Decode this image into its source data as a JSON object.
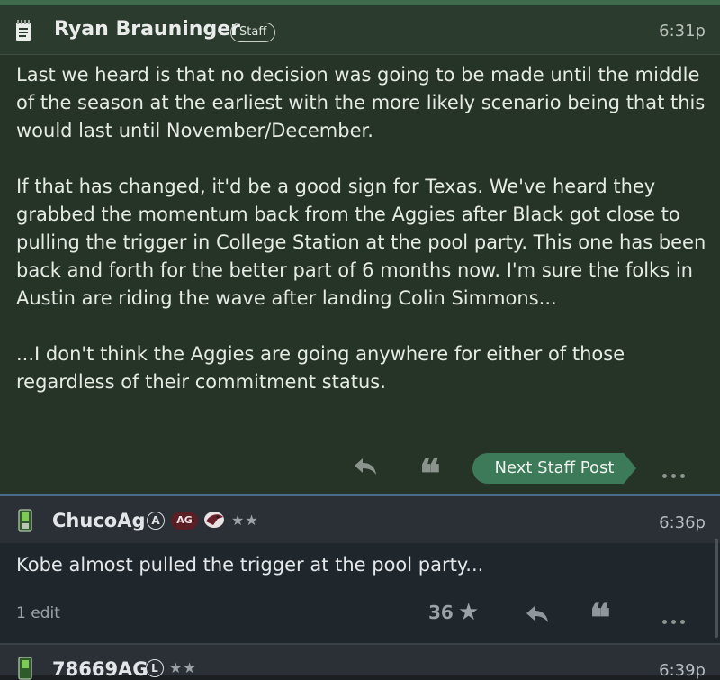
{
  "post1": {
    "author": "Ryan Brauninger",
    "badge": "Staff",
    "time": "6:31p",
    "paragraphs": [
      "Last we heard is that no decision was going to be made until the middle of the season at the earliest with the more likely scenario being that this would last until November/December.",
      "If that has changed, it'd be a good sign for Texas. We've heard they grabbed the momentum back from the Aggies after Black got close to pulling the trigger in College Station at the pool party. This one has been back and forth for the better part of 6 months now. I'm sure the folks in Austin are riding the wave after landing Colin Simmons...",
      "...I don't think the Aggies are going anywhere for either of those regardless of their commitment status."
    ],
    "next_button": "Next Staff Post"
  },
  "post2": {
    "author": "ChucoAg",
    "badge_a": "A",
    "badge_ag": "AG",
    "stars": "★★",
    "time": "6:36p",
    "body": "Kobe almost pulled the trigger at the pool party...",
    "edits": "1 edit",
    "votes": "36"
  },
  "post3": {
    "author": "78669AG",
    "badge_l": "L",
    "stars": "★★",
    "time": "6:39p"
  },
  "colors": {
    "staff_header": "#2b3b2d",
    "staff_body": "#263428",
    "next_button": "#3d7a59",
    "reply_body": "#1f262c",
    "ag_badge": "#5a1e25"
  }
}
